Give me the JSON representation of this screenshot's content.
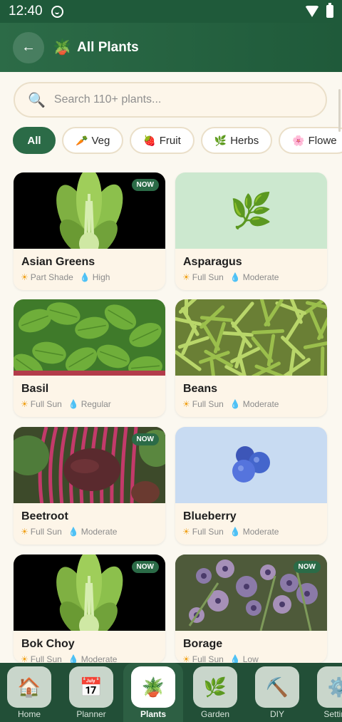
{
  "status_bar": {
    "time": "12:40"
  },
  "header": {
    "back_label": "←",
    "icon": "🪴",
    "title": "All Plants"
  },
  "search": {
    "placeholder": "Search 110+ plants..."
  },
  "filters": [
    {
      "label": "All",
      "emoji": ""
    },
    {
      "label": "Veg",
      "emoji": "🥕"
    },
    {
      "label": "Fruit",
      "emoji": "🍓"
    },
    {
      "label": "Herbs",
      "emoji": "🌿"
    },
    {
      "label": "Flowe",
      "emoji": "🌸"
    }
  ],
  "badge_label": "NOW",
  "plants": [
    {
      "name": "Asian Greens",
      "sun": "Part Shade",
      "water": "High",
      "now": true,
      "image": "leafy-greens",
      "bg": "#000000"
    },
    {
      "name": "Asparagus",
      "sun": "Full Sun",
      "water": "Moderate",
      "now": false,
      "image": "herb-sprig",
      "emoji": "🌿",
      "bg": "#cce8cf"
    },
    {
      "name": "Basil",
      "sun": "Full Sun",
      "water": "Regular",
      "now": false,
      "image": "basil-leaves",
      "bg": "#3f7a2a"
    },
    {
      "name": "Beans",
      "sun": "Full Sun",
      "water": "Moderate",
      "now": false,
      "image": "green-beans",
      "bg": "#6a7f35"
    },
    {
      "name": "Beetroot",
      "sun": "Full Sun",
      "water": "Moderate",
      "now": true,
      "image": "beetroot",
      "bg": "#4a3a2a"
    },
    {
      "name": "Blueberry",
      "sun": "Full Sun",
      "water": "Moderate",
      "now": false,
      "image": "blueberries",
      "bg": "#c8dbf2"
    },
    {
      "name": "Bok Choy",
      "sun": "Full Sun",
      "water": "Moderate",
      "now": true,
      "image": "leafy-greens",
      "bg": "#000000"
    },
    {
      "name": "Borage",
      "sun": "Full Sun",
      "water": "Low",
      "now": true,
      "image": "borage-flowers",
      "bg": "#5b6a45"
    }
  ],
  "nav": [
    {
      "label": "Home",
      "icon": "🏠"
    },
    {
      "label": "Planner",
      "icon": "📅"
    },
    {
      "label": "Plants",
      "icon": "🪴"
    },
    {
      "label": "Garden",
      "icon": "🌿"
    },
    {
      "label": "DIY",
      "icon": "⛏️"
    },
    {
      "label": "Settings",
      "icon": "⚙️"
    }
  ],
  "nav_active": "Plants",
  "colors": {
    "primary": "#2b6b47",
    "header": "#1f5a3a",
    "card": "#fdf5e8",
    "background": "#fbf8f0"
  }
}
